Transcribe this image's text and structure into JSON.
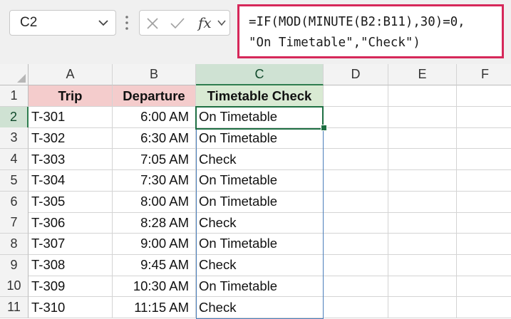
{
  "name_box": {
    "value": "C2"
  },
  "formula_bar": {
    "line1": "=IF(MOD(MINUTE(B2:B11),30)=0,",
    "line2": "\"On Timetable\",\"Check\")"
  },
  "fx_label": "fx",
  "colors": {
    "highlight_border": "#d6285a",
    "trip_header_fill": "#f4cccc",
    "departure_header_fill": "#f4cccc",
    "check_header_fill": "#d9ead3",
    "selection_green": "#1e6f43",
    "range_blue": "#4a7ebb"
  },
  "columns": [
    "A",
    "B",
    "C",
    "D",
    "E",
    "F"
  ],
  "rows": [
    "1",
    "2",
    "3",
    "4",
    "5",
    "6",
    "7",
    "8",
    "9",
    "10",
    "11"
  ],
  "header": {
    "trip": "Trip",
    "departure": "Departure",
    "check": "Timetable Check"
  },
  "data": [
    {
      "trip": "T-301",
      "departure": "6:00 AM",
      "check": "On Timetable"
    },
    {
      "trip": "T-302",
      "departure": "6:30 AM",
      "check": "On Timetable"
    },
    {
      "trip": "T-303",
      "departure": "7:05 AM",
      "check": "Check"
    },
    {
      "trip": "T-304",
      "departure": "7:30 AM",
      "check": "On Timetable"
    },
    {
      "trip": "T-305",
      "departure": "8:00 AM",
      "check": "On Timetable"
    },
    {
      "trip": "T-306",
      "departure": "8:28 AM",
      "check": "Check"
    },
    {
      "trip": "T-307",
      "departure": "9:00 AM",
      "check": "On Timetable"
    },
    {
      "trip": "T-308",
      "departure": "9:45 AM",
      "check": "Check"
    },
    {
      "trip": "T-309",
      "departure": "10:30 AM",
      "check": "On Timetable"
    },
    {
      "trip": "T-310",
      "departure": "11:15 AM",
      "check": "Check"
    }
  ]
}
